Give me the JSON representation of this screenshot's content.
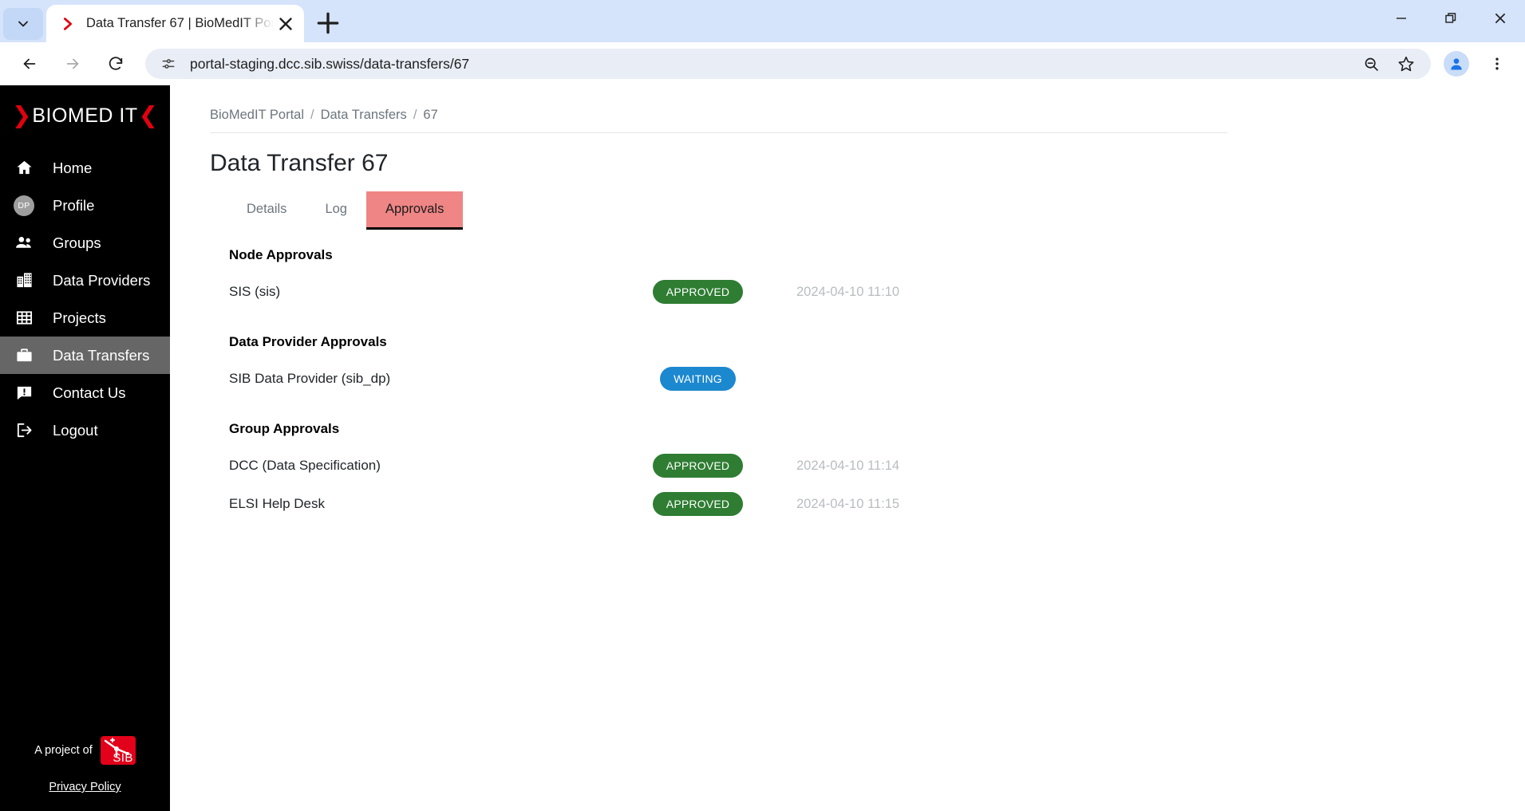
{
  "browser": {
    "tab": {
      "title": "Data Transfer 67 | BioMedIT Por",
      "favicon_name": "biomedit-chevron-favicon",
      "close_label": "✕"
    },
    "tab_search_name": "tab-search-icon",
    "new_tab_label": "+",
    "window_controls": {
      "minimize": "—",
      "maximize": "❐",
      "close": "✕"
    },
    "toolbar": {
      "back_label": "←",
      "forward_label": "→",
      "reload_label": "↻",
      "site_info_name": "site-settings-icon",
      "url": "portal-staging.dcc.sib.swiss/data-transfers/67",
      "zoom_out_name": "zoom-out-icon",
      "bookmark_name": "bookmark-star-icon",
      "profile_name": "profile-avatar-icon",
      "menu_name": "three-dot-menu-icon"
    }
  },
  "sidebar": {
    "logo": {
      "left_chevron": "❯",
      "word": "BIOMED IT",
      "right_chevron": "❮",
      "accent": "#e3000f"
    },
    "items": [
      {
        "label": "Home",
        "icon": "home-icon",
        "active": false
      },
      {
        "label": "Profile",
        "icon": "profile-initials-avatar",
        "initials": "DP",
        "active": false
      },
      {
        "label": "Groups",
        "icon": "people-icon",
        "active": false
      },
      {
        "label": "Data Providers",
        "icon": "building-icon",
        "active": false
      },
      {
        "label": "Projects",
        "icon": "grid-icon",
        "active": false
      },
      {
        "label": "Data Transfers",
        "icon": "briefcase-icon",
        "active": true
      },
      {
        "label": "Contact Us",
        "icon": "message-alert-icon",
        "active": false
      },
      {
        "label": "Logout",
        "icon": "logout-icon",
        "active": false
      }
    ],
    "footer": {
      "project_of": "A project of",
      "sib_logo_name": "sib-logo",
      "sib_logo_text": "SIB",
      "privacy_policy": "Privacy Policy"
    }
  },
  "main": {
    "breadcrumb": [
      {
        "label": "BioMedIT Portal"
      },
      {
        "label": "Data Transfers"
      },
      {
        "label": "67"
      }
    ],
    "breadcrumb_separator": "/",
    "page_title": "Data Transfer 67",
    "tabs": [
      {
        "label": "Details",
        "active": false
      },
      {
        "label": "Log",
        "active": false
      },
      {
        "label": "Approvals",
        "active": true
      }
    ],
    "colors": {
      "active_tab_bg": "#ef8585",
      "approved": "#2e7d32",
      "waiting": "#1b88cf"
    },
    "sections": [
      {
        "heading": "Node Approvals",
        "rows": [
          {
            "name": "SIS (sis)",
            "status": "APPROVED",
            "status_color": "#2e7d32",
            "timestamp": "2024-04-10 11:10"
          }
        ]
      },
      {
        "heading": "Data Provider Approvals",
        "rows": [
          {
            "name": "SIB Data Provider (sib_dp)",
            "status": "WAITING",
            "status_color": "#1b88cf",
            "timestamp": ""
          }
        ]
      },
      {
        "heading": "Group Approvals",
        "rows": [
          {
            "name": "DCC (Data Specification)",
            "status": "APPROVED",
            "status_color": "#2e7d32",
            "timestamp": "2024-04-10 11:14"
          },
          {
            "name": "ELSI Help Desk",
            "status": "APPROVED",
            "status_color": "#2e7d32",
            "timestamp": "2024-04-10 11:15"
          }
        ]
      }
    ]
  }
}
